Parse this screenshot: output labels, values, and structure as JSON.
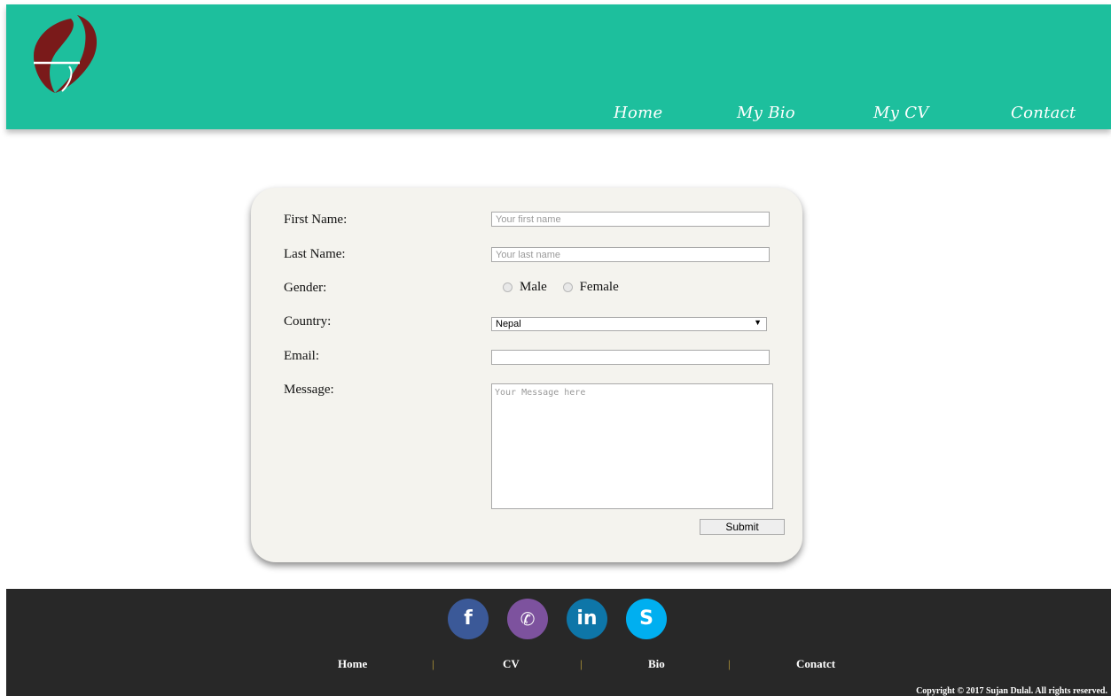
{
  "header": {
    "nav": [
      "Home",
      "My Bio",
      "My CV",
      "Contact"
    ],
    "bg_color": "#1dbf9d"
  },
  "form": {
    "labels": {
      "first_name": "First Name:",
      "last_name": "Last Name:",
      "gender": "Gender:",
      "country": "Country:",
      "email": "Email:",
      "message": "Message:"
    },
    "first_name_placeholder": "Your first name",
    "last_name_placeholder": "Your last name",
    "gender_options": [
      "Male",
      "Female"
    ],
    "country_selected": "Nepal",
    "email_value": "",
    "message_placeholder": "Your Message here",
    "submit_label": "Submit"
  },
  "footer": {
    "social": [
      {
        "name": "facebook-icon",
        "glyph": "f",
        "color": "#3b5998"
      },
      {
        "name": "viber-icon",
        "glyph": "✆",
        "color": "#7d529e"
      },
      {
        "name": "linkedin-icon",
        "glyph": "in",
        "color": "#0e76a8"
      },
      {
        "name": "skype-icon",
        "glyph": "S",
        "color": "#00aff0"
      }
    ],
    "nav": [
      "Home",
      "CV",
      "Bio",
      "Conatct"
    ],
    "separator": "|",
    "copyright": "Copyright © 2017 Sujan Dulal. All rights reserved."
  }
}
